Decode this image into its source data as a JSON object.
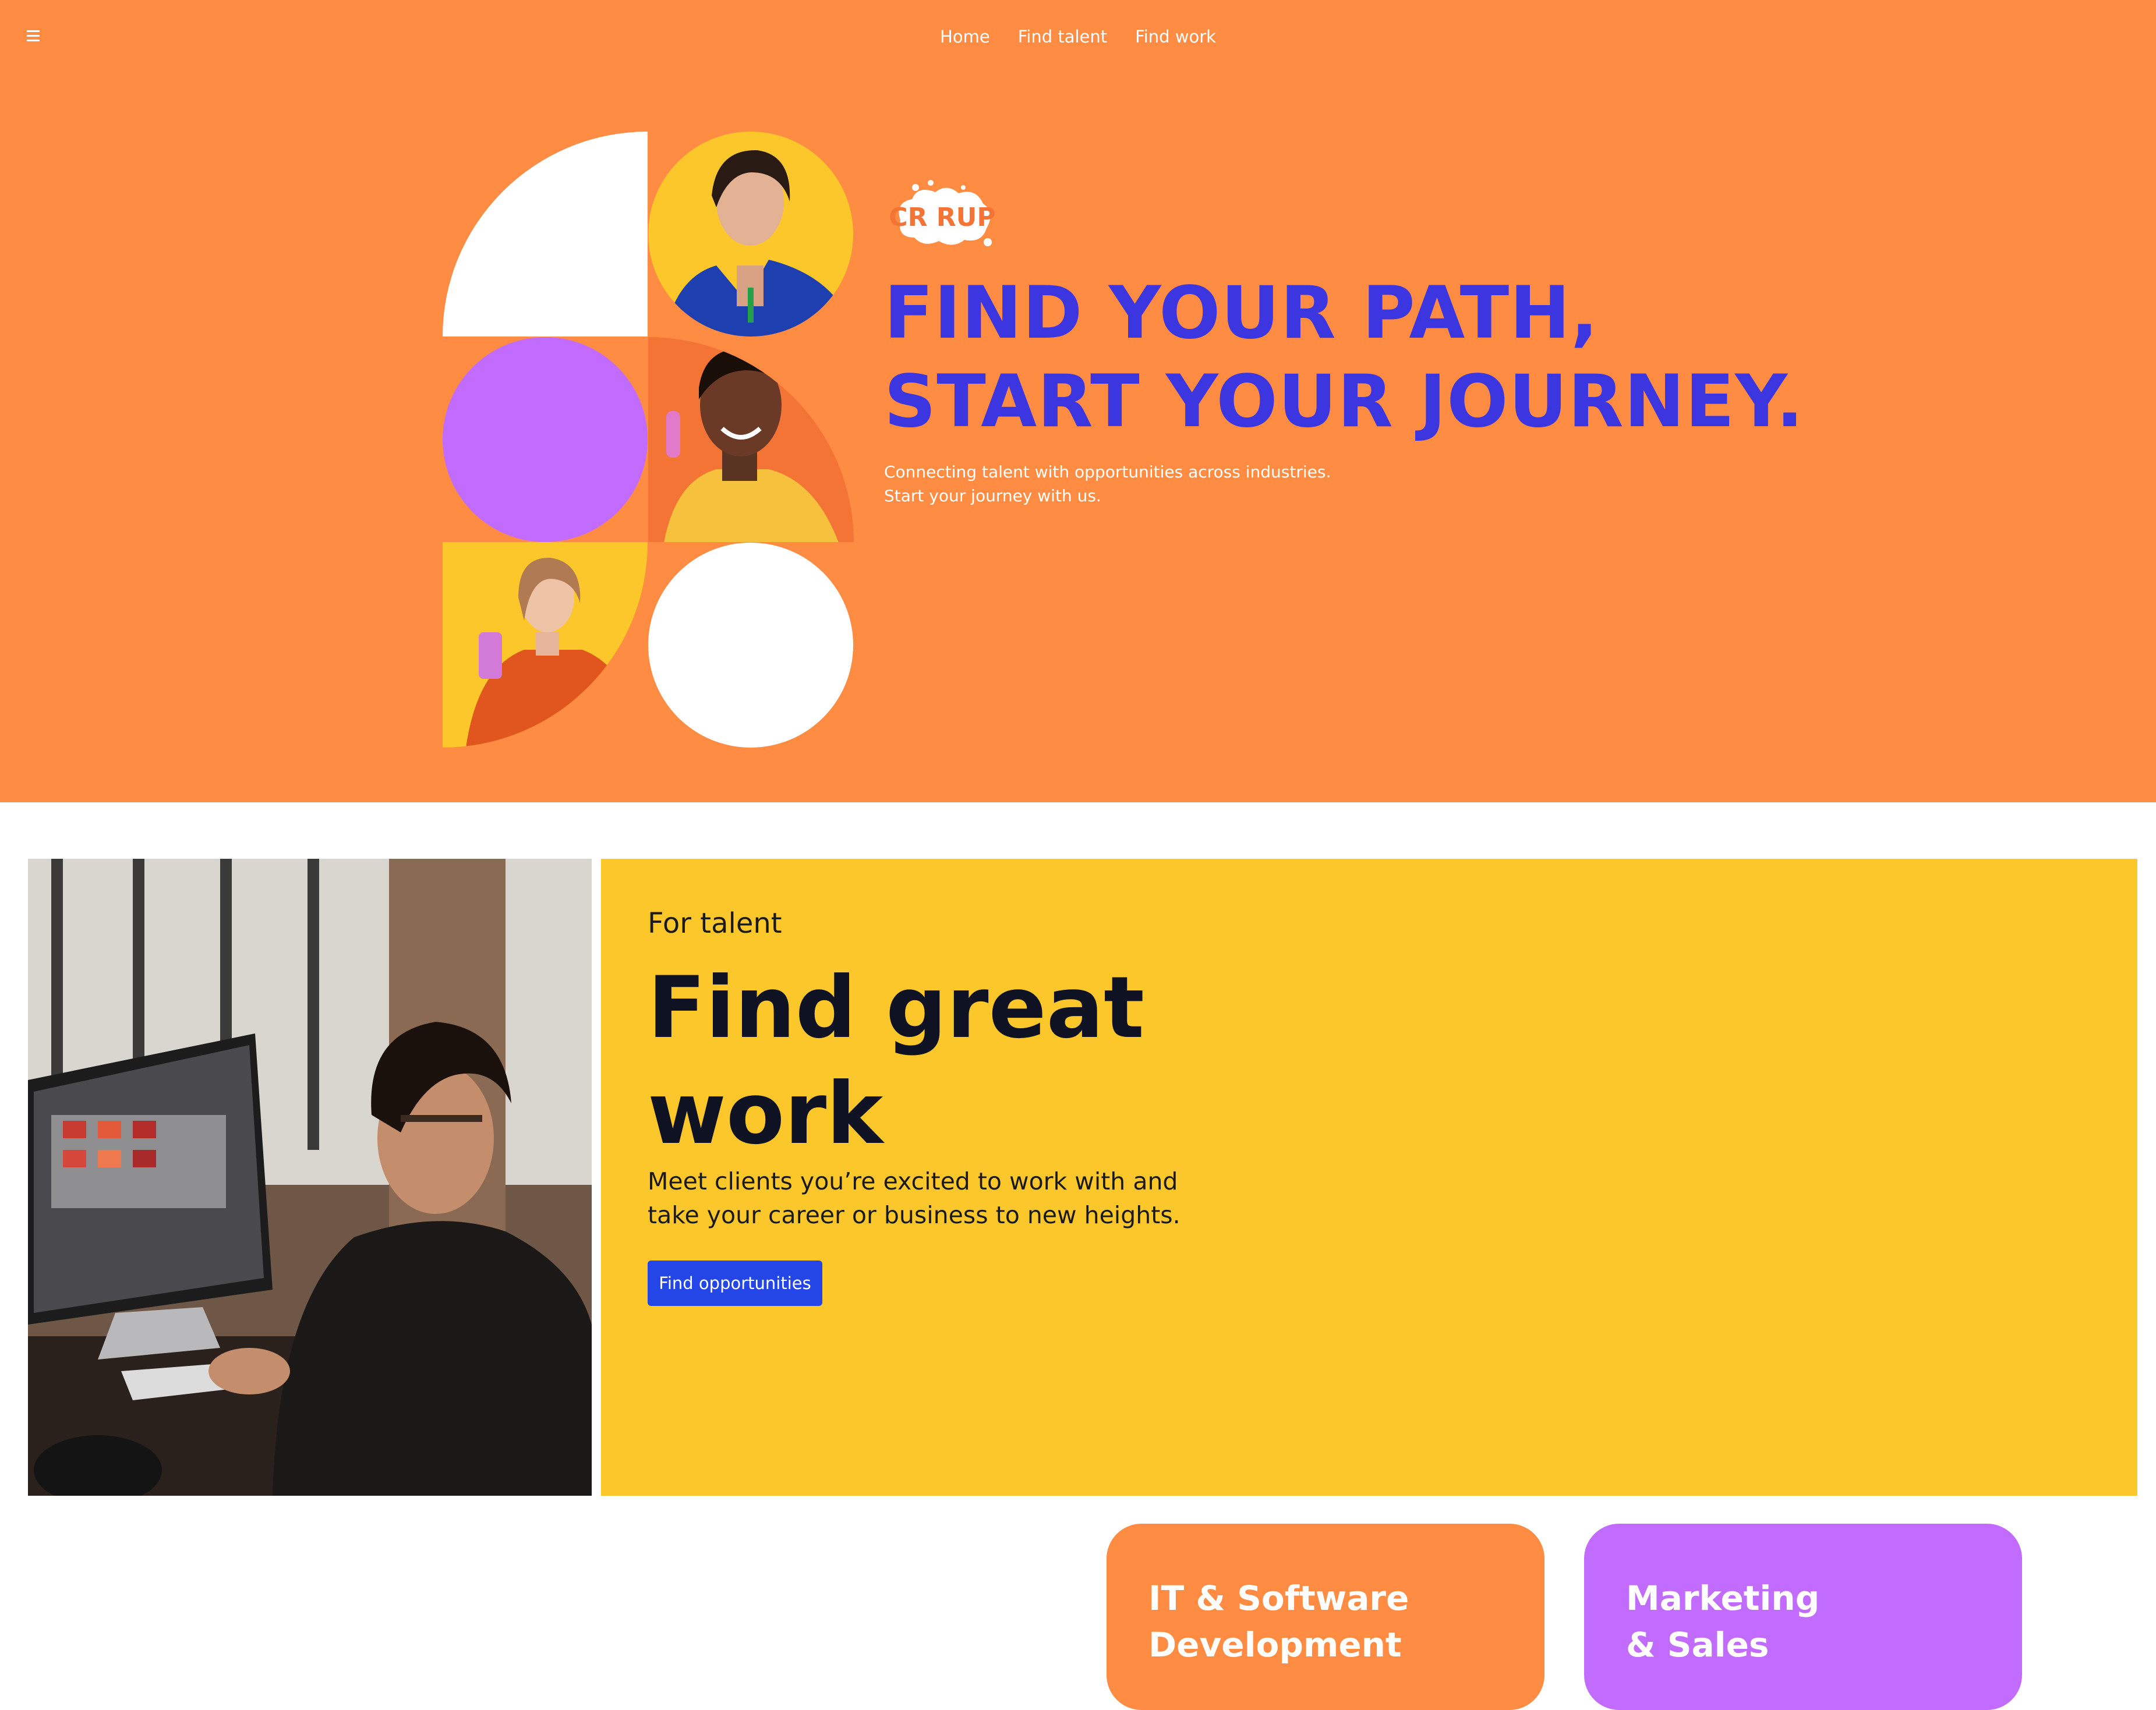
{
  "nav": {
    "menu_icon": "hamburger-menu-icon",
    "links": [
      "Home",
      "Find talent",
      "Find work"
    ]
  },
  "hero": {
    "logo_text": "CR RUP",
    "headline_line1": "FIND YOUR PATH,",
    "headline_line2": "START YOUR JOURNEY.",
    "sub_line1": "Connecting talent with opportunities across industries.",
    "sub_line2": "Start your journey with us."
  },
  "talent": {
    "eyebrow": "For talent",
    "title": "Find great work",
    "description": "Meet clients you’re excited to work with and take your career or business to new heights.",
    "cta": "Find opportunities"
  },
  "categories": [
    {
      "title": "IT & Software\nDevelopment"
    },
    {
      "title": "Marketing\n& Sales"
    }
  ],
  "colors": {
    "hero_bg": "#FF8C42",
    "headline": "#3B36E0",
    "talent_bg": "#FCC72A",
    "cta_bg": "#2446E6",
    "purple": "#C26CFF"
  }
}
